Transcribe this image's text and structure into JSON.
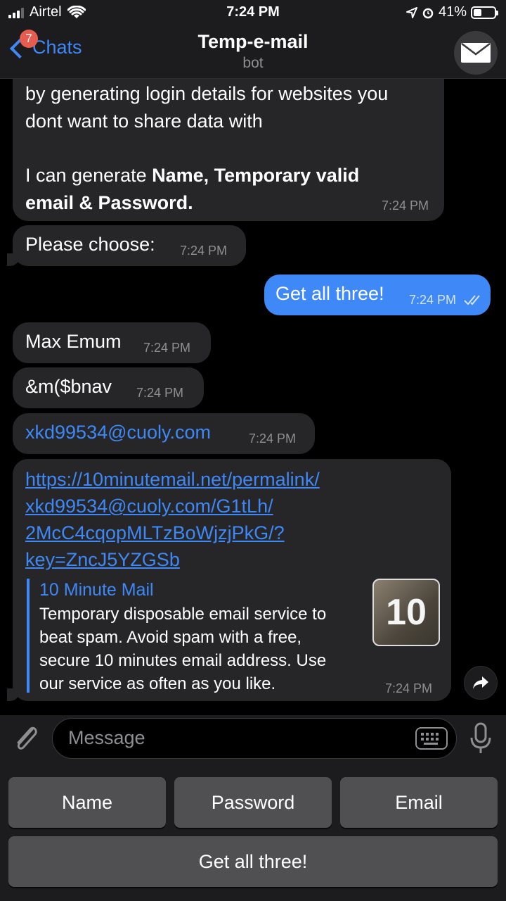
{
  "status_bar": {
    "carrier": "Airtel",
    "time": "7:24 PM",
    "battery": "41%"
  },
  "header": {
    "back_label": "Chats",
    "unread_badge": "7",
    "title": "Temp-e-mail",
    "subtitle": "bot"
  },
  "messages": {
    "intro": {
      "line1": "by generating login details for websites you",
      "line2": "dont want to share data with",
      "line3_plain": "I can generate ",
      "line3_bold": "Name, Temporary valid",
      "line4_bold": "email & Password.",
      "time": "7:24 PM"
    },
    "choose": {
      "text": "Please choose:",
      "time": "7:24 PM"
    },
    "get_all": {
      "text": "Get all three!",
      "time": "7:24 PM"
    },
    "name": {
      "text": "Max Emum",
      "time": "7:24 PM"
    },
    "password": {
      "text": "&m($bnav",
      "time": "7:24 PM"
    },
    "email": {
      "text": "xkd99534@cuoly.com",
      "time": "7:24 PM"
    },
    "permalink": {
      "url_lines": [
        "https://10minutemail.net/permalink/",
        "xkd99534@cuoly.com/G1tLh/",
        "2McC4cqopMLTzBoWjzjPkG/?",
        "key=ZncJ5YZGSb"
      ],
      "preview_site": "10 Minute Mail",
      "preview_lines": [
        "Temporary disposable email service to",
        "beat spam. Avoid spam with a free,",
        "secure 10 minutes email address. Use",
        "our service as often as you like."
      ],
      "preview_thumb_text": "10",
      "time": "7:24 PM"
    }
  },
  "composer": {
    "placeholder": "Message"
  },
  "reply_keyboard": {
    "row1": [
      "Name",
      "Password",
      "Email"
    ],
    "row2": [
      "Get all three!"
    ]
  },
  "colors": {
    "accent": "#3e88f7",
    "incoming_bubble": "#262628",
    "background": "#000000",
    "bar": "#1c1c1e"
  },
  "icons": {
    "back": "chevron-left-icon",
    "avatar": "envelope-icon",
    "attach": "paperclip-icon",
    "keyboard": "keyboard-icon",
    "mic": "microphone-icon",
    "share": "share-arrow-icon"
  }
}
